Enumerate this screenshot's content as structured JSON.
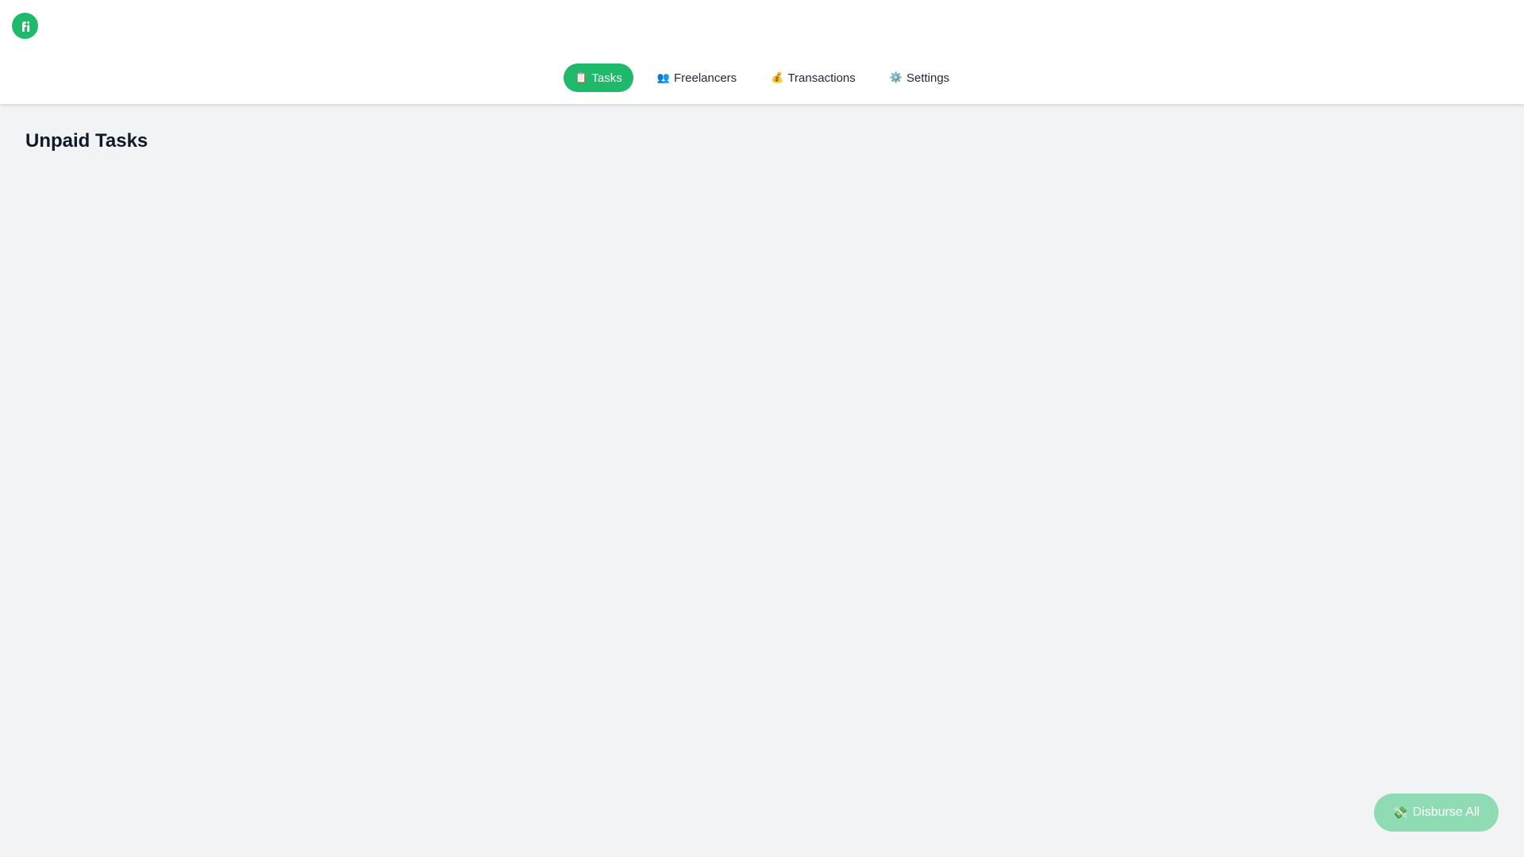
{
  "app": {
    "logo_icon": "fi-logo-icon",
    "brand_color": "#1fb96b"
  },
  "nav": {
    "items": [
      {
        "icon": "📋",
        "icon_name": "clipboard-icon",
        "label": "Tasks",
        "active": true
      },
      {
        "icon": "👥",
        "icon_name": "people-icon",
        "label": "Freelancers",
        "active": false
      },
      {
        "icon": "💰",
        "icon_name": "money-bag-icon",
        "label": "Transactions",
        "active": false
      },
      {
        "icon": "⚙️",
        "icon_name": "gear-icon",
        "label": "Settings",
        "active": false
      }
    ]
  },
  "main": {
    "title": "Unpaid Tasks"
  },
  "fab": {
    "icon": "💸",
    "icon_name": "money-with-wings-icon",
    "label": "Disburse All",
    "color": "#8fdcb4"
  }
}
